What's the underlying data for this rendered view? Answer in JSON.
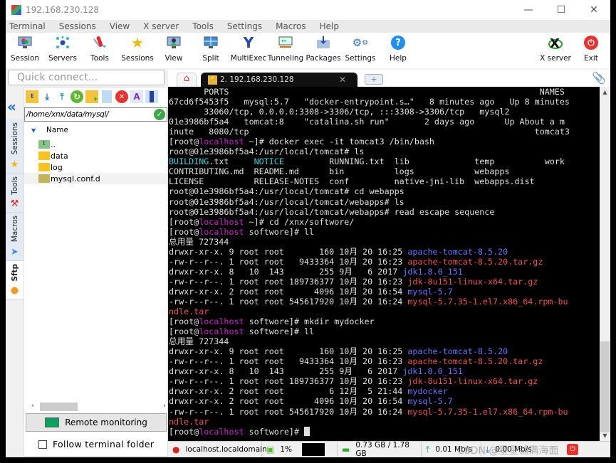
{
  "window": {
    "title": "192.168.230.128",
    "controls": {
      "minimize": "—",
      "maximize": "☐",
      "close": "✕"
    }
  },
  "menu": [
    "Terminal",
    "Sessions",
    "View",
    "X server",
    "Tools",
    "Settings",
    "Macros",
    "Help"
  ],
  "toolbar": [
    {
      "label": "Session",
      "icon": "session-icon"
    },
    {
      "label": "Servers",
      "icon": "servers-icon"
    },
    {
      "label": "Tools",
      "icon": "tools-icon"
    },
    {
      "label": "Sessions",
      "icon": "sessions-star-icon"
    },
    {
      "label": "View",
      "icon": "view-icon"
    },
    {
      "label": "Split",
      "icon": "split-icon"
    },
    {
      "label": "MultiExec",
      "icon": "multiexec-icon"
    },
    {
      "label": "Tunneling",
      "icon": "tunneling-icon"
    },
    {
      "label": "Packages",
      "icon": "packages-icon"
    },
    {
      "label": "Settings",
      "icon": "settings-icon"
    },
    {
      "label": "Help",
      "icon": "help-icon"
    },
    {
      "label": "X server",
      "icon": "x-server-icon"
    },
    {
      "label": "Exit",
      "icon": "exit-icon"
    }
  ],
  "quick_connect": {
    "placeholder": "Quick connect..."
  },
  "side_tabs": [
    {
      "label": "Sessions",
      "icon": "★"
    },
    {
      "label": "Tools",
      "icon": "⚒"
    },
    {
      "label": "Macros",
      "icon": "➤"
    },
    {
      "label": "Sftp",
      "icon": "●",
      "active": true
    }
  ],
  "sftp": {
    "path": "/home/xnx/data/mysql/",
    "column_name": "Name",
    "items": [
      {
        "name": "..",
        "type": "parent"
      },
      {
        "name": "data",
        "type": "folder"
      },
      {
        "name": "log",
        "type": "folder"
      },
      {
        "name": "mysql.conf.d",
        "type": "folder-special",
        "selected": true
      }
    ],
    "remote_monitoring": "Remote monitoring",
    "follow_folder": "Follow terminal folder",
    "follow_checked": false
  },
  "tabs": {
    "home_icon": "⌂",
    "session_tab": "2. 192.168.230.128",
    "close": "✕",
    "new_tab": "+"
  },
  "terminal": {
    "lines": [
      [
        {
          "t": "       PORTS                                                              NAMES"
        }
      ],
      [
        {
          "t": "67cd6f5453f5   mysql:5.7   \"docker-entrypoint.s…\"   8 minutes ago   Up 8 minutes"
        }
      ],
      [
        {
          "t": "       33060/tcp, 0.0.0.0:3308->3306/tcp, :::3308->3306/tcp   mysql2"
        }
      ],
      [
        {
          "t": "01e3986bf5a4   tomcat:8    \"catalina.sh run\"       2 days ago      Up About a m"
        }
      ],
      [
        {
          "t": "inute   8080/tcp                                                         tomcat3"
        }
      ],
      [
        {
          "t": "[root@"
        },
        {
          "t": "localhost",
          "c": "mag"
        },
        {
          "t": " ~]# docker exec -it tomcat3 /bin/bash"
        }
      ],
      [
        {
          "t": "root@01e3986bf5a4:/usr/local/tomcat# ls"
        }
      ],
      [
        {
          "t": "BUILDING",
          "c": "cyan"
        },
        {
          "t": ".txt     "
        },
        {
          "t": "NOTICE",
          "c": "cyan"
        },
        {
          "t": "         RUNNING.txt  lib             temp          work"
        }
      ],
      [
        {
          "t": "CONTRIBUTING.md  README.md      bin          logs            webapps"
        }
      ],
      [
        {
          "t": "LICENSE          RELEASE-NOTES  conf         native-jni-lib  webapps.dist"
        }
      ],
      [
        {
          "t": "root@01e3986bf5a4:/usr/local/tomcat# cd webapps"
        }
      ],
      [
        {
          "t": "root@01e3986bf5a4:/usr/local/tomcat/webapps# ls"
        }
      ],
      [
        {
          "t": "root@01e3986bf5a4:/usr/local/tomcat/webapps# read escape sequence"
        }
      ],
      [
        {
          "t": "[root@"
        },
        {
          "t": "localhost",
          "c": "mag"
        },
        {
          "t": " ~]# cd /xnx/softwore/"
        }
      ],
      [
        {
          "t": "[root@"
        },
        {
          "t": "localhost",
          "c": "mag"
        },
        {
          "t": " softwore]# ll"
        }
      ],
      [
        {
          "t": "总用量 727344"
        }
      ],
      [
        {
          "t": "drwxr-xr-x. 9 root root       160 10月 20 16:25 "
        },
        {
          "t": "apache-tomcat-8.5.20",
          "c": "blue"
        }
      ],
      [
        {
          "t": "-rw-r--r--. 1 root root   9433364 10月 20 16:23 "
        },
        {
          "t": "apache-tomcat-8.5.20.tar.gz",
          "c": "red"
        }
      ],
      [
        {
          "t": "drwxr-xr-x. 8   10  143       255 9月   6 2017 "
        },
        {
          "t": "jdk1.8.0_151",
          "c": "blue"
        }
      ],
      [
        {
          "t": "-rw-r--r--. 1 root root 189736377 10月 20 16:23 "
        },
        {
          "t": "jdk-8u151-linux-x64.tar.gz",
          "c": "red"
        }
      ],
      [
        {
          "t": "drwxr-xr-x. 2 root root      4096 10月 20 16:54 "
        },
        {
          "t": "mysql-5.7",
          "c": "blue"
        }
      ],
      [
        {
          "t": "-rw-r--r--. 1 root root 545617920 10月 20 16:24 "
        },
        {
          "t": "mysql-5.7.35-1.el7.x86_64.rpm-bu",
          "c": "red"
        }
      ],
      [
        {
          "t": "ndle.tar",
          "c": "red"
        }
      ],
      [
        {
          "t": "[root@"
        },
        {
          "t": "localhost",
          "c": "mag"
        },
        {
          "t": " softwore]# mkdir mydocker"
        }
      ],
      [
        {
          "t": "[root@"
        },
        {
          "t": "localhost",
          "c": "mag"
        },
        {
          "t": " softwore]# ll"
        }
      ],
      [
        {
          "t": "总用量 727344"
        }
      ],
      [
        {
          "t": "drwxr-xr-x. 9 root root       160 10月 20 16:25 "
        },
        {
          "t": "apache-tomcat-8.5.20",
          "c": "blue"
        }
      ],
      [
        {
          "t": "-rw-r--r--. 1 root root   9433364 10月 20 16:23 "
        },
        {
          "t": "apache-tomcat-8.5.20.tar.gz",
          "c": "red"
        }
      ],
      [
        {
          "t": "drwxr-xr-x. 8   10  143       255 9月   6 2017 "
        },
        {
          "t": "jdk1.8.0_151",
          "c": "blue"
        }
      ],
      [
        {
          "t": "-rw-r--r--. 1 root root 189736377 10月 20 16:23 "
        },
        {
          "t": "jdk-8u151-linux-x64.tar.gz",
          "c": "red"
        }
      ],
      [
        {
          "t": "drwxr-xr-x. 2 root root         6 12月  5 21:44 "
        },
        {
          "t": "mydocker",
          "c": "blue"
        }
      ],
      [
        {
          "t": "drwxr-xr-x. 2 root root      4096 10月 20 16:54 "
        },
        {
          "t": "mysql-5.7",
          "c": "blue"
        }
      ],
      [
        {
          "t": "-rw-r--r--. 1 root root 545617920 10月 20 16:24 "
        },
        {
          "t": "mysql-5.7.35-1.el7.x86_64.rpm-bu",
          "c": "red"
        }
      ],
      [
        {
          "t": "ndle.tar",
          "c": "red"
        }
      ],
      [
        {
          "t": "[root@"
        },
        {
          "t": "localhost",
          "c": "mag"
        },
        {
          "t": " softwore]# "
        },
        {
          "cursor": true
        }
      ]
    ]
  },
  "statusbar": {
    "host": "localhost.localdomain",
    "cpu": "1%",
    "memory": "0.73 GB / 1.78 GB",
    "upload": "0.01 Mb/s",
    "download": "0.00 Mb/s",
    "watermark": "CSDN @星星铺满海面"
  }
}
